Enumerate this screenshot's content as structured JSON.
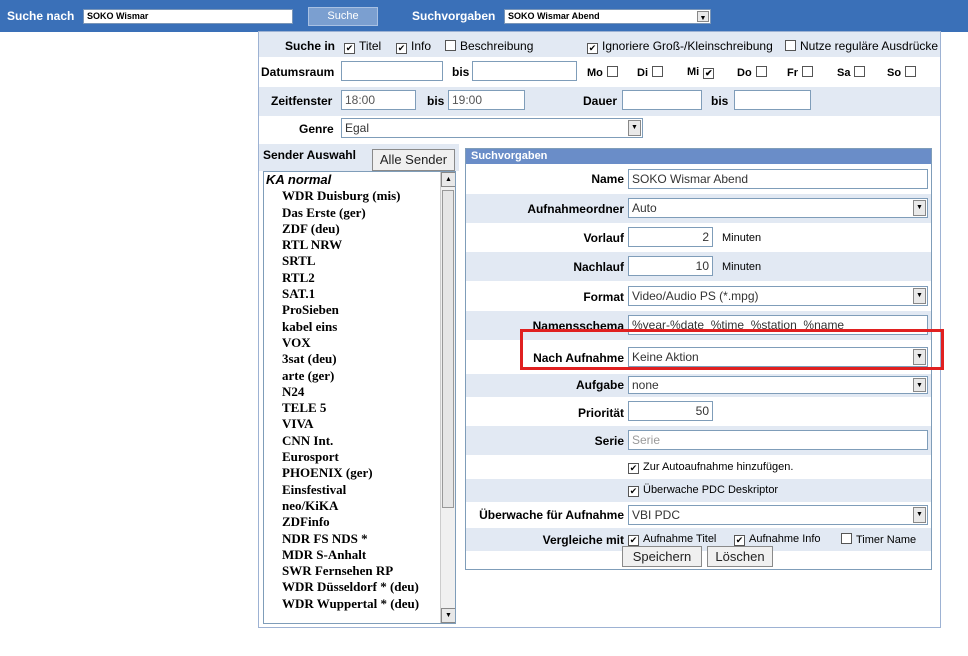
{
  "topbar": {
    "search_label": "Suche nach",
    "search_value": "SOKO Wismar",
    "search_button": "Suche",
    "presets_label": "Suchvorgaben",
    "presets_value": "SOKO Wismar Abend"
  },
  "filters": {
    "search_in_label": "Suche in",
    "title_option": "Titel",
    "info_option": "Info",
    "description_option": "Beschreibung",
    "ignore_case": "Ignoriere Groß-/Kleinschreibung",
    "regex": "Nutze reguläre Ausdrücke",
    "date_range_label": "Datumsraum",
    "to_label": "bis",
    "weekdays": [
      "Mo",
      "Di",
      "Mi",
      "Do",
      "Fr",
      "Sa",
      "So"
    ],
    "weekdays_checked": [
      false,
      false,
      true,
      false,
      false,
      false,
      false
    ],
    "time_window_label": "Zeitfenster",
    "time_from": "18:00",
    "time_to": "19:00",
    "duration_label": "Dauer",
    "genre_label": "Genre",
    "genre_value": "Egal"
  },
  "sender": {
    "label": "Sender Auswahl",
    "all_button": "Alle Sender",
    "group": "KA normal",
    "items": [
      "WDR Duisburg (mis)",
      "Das Erste (ger)",
      "ZDF (deu)",
      "RTL NRW",
      "SRTL",
      "RTL2",
      "SAT.1",
      "ProSieben",
      "kabel eins",
      "VOX",
      "3sat (deu)",
      "arte (ger)",
      "N24",
      "TELE 5",
      "VIVA",
      "CNN Int.",
      "Eurosport",
      "PHOENIX (ger)",
      "Einsfestival",
      "neo/KiKA",
      "ZDFinfo",
      "NDR FS NDS *",
      "MDR S-Anhalt",
      "SWR Fernsehen RP",
      "WDR Düsseldorf * (deu)",
      "WDR Wuppertal * (deu)"
    ]
  },
  "preset": {
    "header": "Suchvorgaben",
    "name_label": "Name",
    "name_value": "SOKO Wismar Abend",
    "folder_label": "Aufnahmeordner",
    "folder_value": "Auto",
    "prerun_label": "Vorlauf",
    "prerun_value": "2",
    "postrun_label": "Nachlauf",
    "postrun_value": "10",
    "minutes": "Minuten",
    "format_label": "Format",
    "format_value": "Video/Audio PS (*.mpg)",
    "naming_label": "Namensschema",
    "naming_value": "%year-%date_%time_%station_%name",
    "after_label": "Nach Aufnahme",
    "after_value": "Keine Aktion",
    "task_label": "Aufgabe",
    "task_value": "none",
    "priority_label": "Priorität",
    "priority_value": "50",
    "series_label": "Serie",
    "series_placeholder": "Serie",
    "auto_add": "Zur Autoaufnahme hinzufügen.",
    "pdc_monitor": "Überwache PDC Deskriptor",
    "monitor_label": "Überwache für Aufnahme",
    "monitor_value": "VBI PDC",
    "compare_label": "Vergleiche mit",
    "compare_title": "Aufnahme Titel",
    "compare_info": "Aufnahme Info",
    "compare_timer": "Timer Name",
    "save_button": "Speichern",
    "delete_button": "Löschen"
  }
}
